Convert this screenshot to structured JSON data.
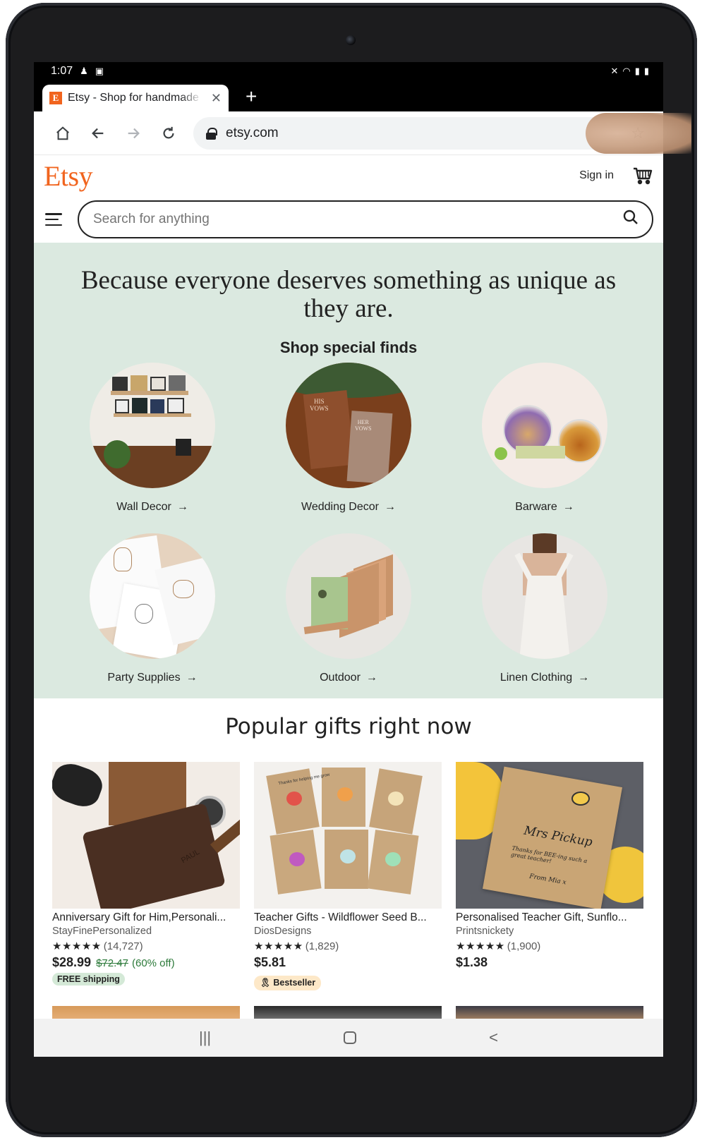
{
  "status_bar": {
    "time": "1:07",
    "icons": [
      "person-icon",
      "notification-icon",
      "mute-icon",
      "wifi-icon",
      "signal-icon",
      "battery-icon"
    ]
  },
  "browser": {
    "tab_title": "Etsy - Shop for handmade",
    "tab_favicon_letter": "E",
    "new_tab_glyph": "+",
    "url": "etsy.com"
  },
  "site": {
    "logo": "Etsy",
    "sign_in": "Sign in",
    "search_placeholder": "Search for anything"
  },
  "hero": {
    "headline": "Because everyone deserves something as unique as they are.",
    "subhead": "Shop special finds",
    "categories": [
      {
        "label": "Wall Decor"
      },
      {
        "label": "Wedding Decor"
      },
      {
        "label": "Barware"
      },
      {
        "label": "Party Supplies"
      },
      {
        "label": "Outdoor"
      },
      {
        "label": "Linen Clothing"
      }
    ],
    "arrow": "→"
  },
  "popular": {
    "heading": "Popular gifts right now",
    "items": [
      {
        "title": "Anniversary Gift for Him,Personali...",
        "shop": "StayFinePersonalized",
        "stars": "★★★★★",
        "reviews": "(14,727)",
        "price": "$28.99",
        "original_price": "$72.47",
        "discount": "(60% off)",
        "badge": "FREE shipping"
      },
      {
        "title": "Teacher Gifts - Wildflower Seed B...",
        "shop": "DiosDesigns",
        "stars": "★★★★★",
        "reviews": "(1,829)",
        "price": "$5.81",
        "badge": "Bestseller"
      },
      {
        "title": "Personalised Teacher Gift, Sunflo...",
        "shop": "Printsnickety",
        "stars": "★★★★★",
        "reviews": "(1,900)",
        "price": "$1.38"
      }
    ],
    "card2_image_text": "Thanks for helping me grow",
    "card3_image_text_1": "Mrs Pickup",
    "card3_image_text_2": "Thanks for BEE-ing such a great teacher!",
    "card3_image_text_3": "From Mia x",
    "card1_image_text": "PAUL"
  },
  "navbar": {
    "recent": "|||",
    "back": "<"
  },
  "colors": {
    "etsy_orange": "#f1641e",
    "hero_bg": "#dbe9e0",
    "discount_green": "#2c7a3a",
    "shipping_badge": "#d4e9d7",
    "bestseller_badge": "#fde8c8"
  }
}
